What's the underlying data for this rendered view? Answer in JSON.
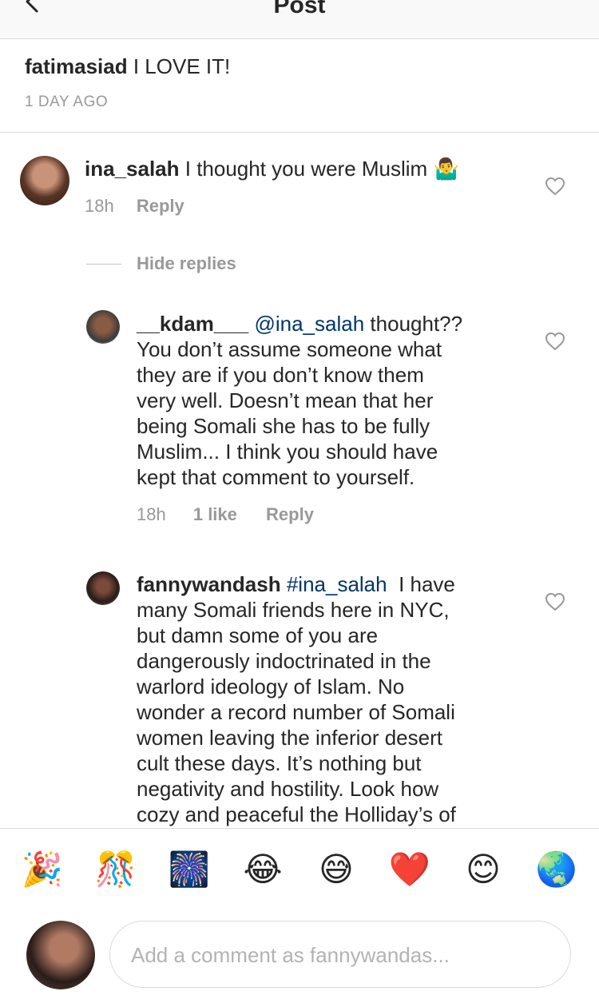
{
  "header": {
    "title": "Post"
  },
  "post": {
    "username": "fatimasiad",
    "caption": "I LOVE IT!",
    "time": "1 DAY AGO"
  },
  "comments": [
    {
      "username": "ina_salah",
      "text": "I thought you were Muslim",
      "emoji": "🤷‍♂️",
      "time": "18h",
      "reply_label": "Reply",
      "hide_replies": "Hide replies"
    }
  ],
  "replies": [
    {
      "username": "__kdam___",
      "mention": "@ina_salah",
      "lines": [
        "thought??",
        "You don’t assume someone what",
        "they are if you don’t know them",
        "very well. Doesn’t mean that her",
        "being Somali she has to be fully",
        "Muslim... I think you should have",
        "kept that comment to yourself."
      ],
      "time": "18h",
      "likes": "1 like",
      "reply_label": "Reply"
    },
    {
      "username": "fannywandash",
      "mention": "#ina_salah",
      "lines": [
        "I have",
        "many Somali friends here in NYC,",
        "but damn some of you are",
        "dangerously indoctrinated in the",
        "warlord ideology of Islam. No",
        "wonder a record number of Somali",
        "women leaving the inferior desert",
        "cult these days. It’s nothing but",
        "negativity and hostility. Look how",
        "cozy and peaceful the Holliday’s of"
      ]
    }
  ],
  "emoji_bar": [
    "🎉",
    "🎊",
    "🎆",
    "😂",
    "😅",
    "❤️",
    "😊",
    "🌏"
  ],
  "comment_input": {
    "placeholder": "Add a comment as fannywandas..."
  }
}
